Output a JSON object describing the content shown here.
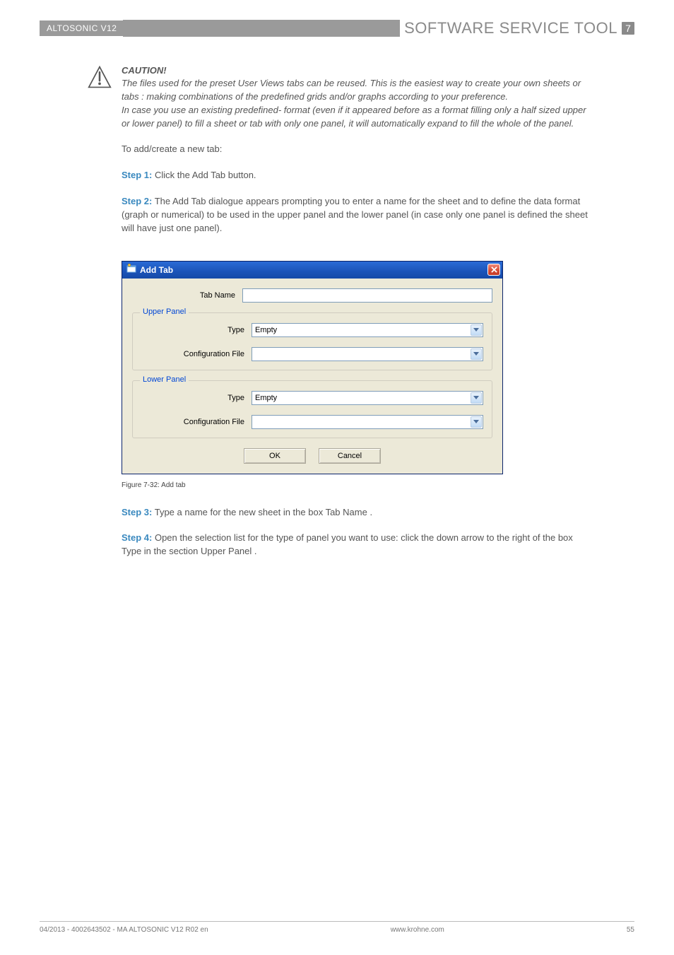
{
  "header": {
    "product": "ALTOSONIC V12",
    "title": "SOFTWARE SERVICE TOOL",
    "badge": "7"
  },
  "caution": {
    "title": "CAUTION!",
    "para1": "The files used for the preset  User Views  tabs can be reused. This is the easiest way to create your own  sheets  or  tabs  : making combinations of the predefined grids and/or graphs according to your preference.",
    "para2": "In case you use an existing    predefined- format (even if it appeared before as a format filling only a half sized upper or lower panel) to fill a sheet or tab with only one panel, it will automatically expand to fill the whole of the panel."
  },
  "intro_line": "To add/create a new tab:",
  "step1_label": "Step 1:",
  "step1_text": " Click the  Add Tab  button.",
  "step2_label": "Step 2:",
  "step2_text": " The  Add Tab  dialogue appears prompting you to enter a name for the sheet and to define the data format (graph or numerical) to be used in the upper panel and the lower panel (in case only one panel is defined the sheet will have just one panel).",
  "dialog": {
    "title": "Add Tab",
    "tab_name_label": "Tab Name",
    "tab_name_value": "",
    "upper_legend": "Upper Panel",
    "lower_legend": "Lower Panel",
    "type_label": "Type",
    "config_label": "Configuration File",
    "upper_type_value": "Empty",
    "upper_config_value": "",
    "lower_type_value": "Empty",
    "lower_config_value": "",
    "ok_label": "OK",
    "cancel_label": "Cancel"
  },
  "figcap": "Figure 7-32: Add tab",
  "step3_label": "Step 3:",
  "step3_text": " Type a name for the new sheet in the box  Tab Name .",
  "step4_label": "Step 4:",
  "step4_text": " Open the selection list for the type of panel you want to use: click the down arrow to the right of the box  Type  in the section  Upper Panel .",
  "footer": {
    "left": "04/2013 - 4002643502 - MA ALTOSONIC V12 R02 en",
    "center": "www.krohne.com",
    "right": "55"
  }
}
